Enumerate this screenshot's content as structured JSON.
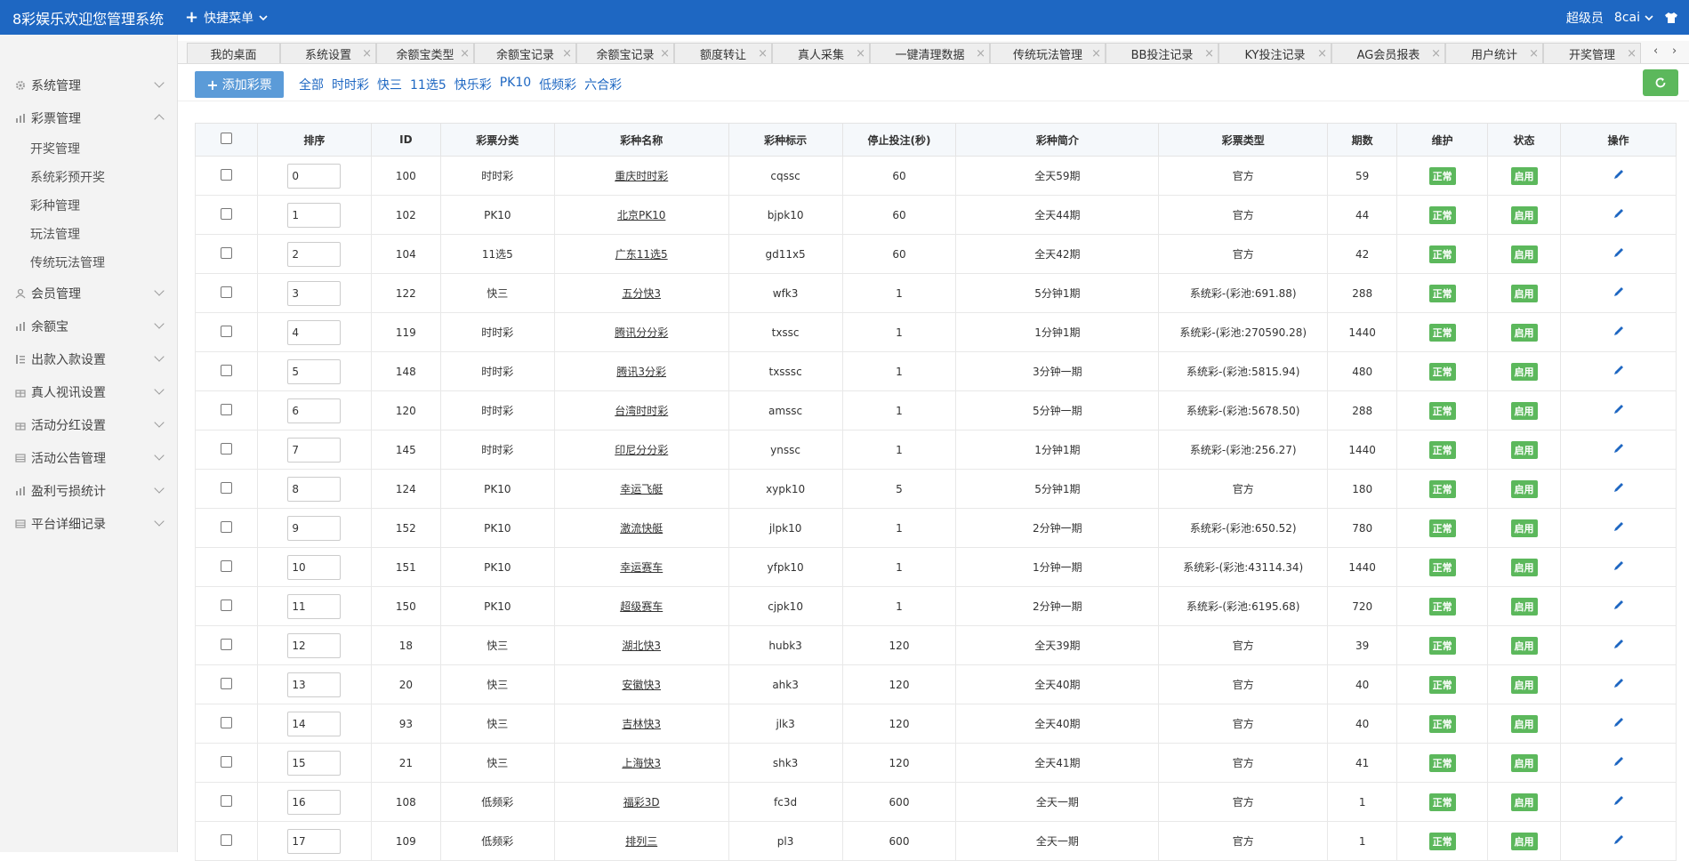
{
  "topbar": {
    "brand": "8彩娱乐欢迎您管理系统",
    "quick_menu": "快捷菜单",
    "role": "超级员",
    "user": "8cai"
  },
  "sidebar": {
    "items": [
      {
        "label": "系统管理"
      },
      {
        "label": "彩票管理"
      },
      {
        "label": "会员管理"
      },
      {
        "label": "余额宝"
      },
      {
        "label": "出款入款设置"
      },
      {
        "label": "真人视讯设置"
      },
      {
        "label": "活动分红设置"
      },
      {
        "label": "活动公告管理"
      },
      {
        "label": "盈利亏损统计"
      },
      {
        "label": "平台详细记录"
      }
    ],
    "subitems": [
      "开奖管理",
      "系统彩预开奖",
      "彩种管理",
      "玩法管理",
      "传统玩法管理"
    ]
  },
  "tabs": [
    "我的桌面",
    "系统设置",
    "余额宝类型",
    "余额宝记录",
    "余额宝记录",
    "额度转让",
    "真人采集",
    "一键清理数据",
    "传统玩法管理",
    "BB投注记录",
    "KY投注记录",
    "AG会员报表",
    "用户统计",
    "开奖管理"
  ],
  "toolbar": {
    "add_label": "添加彩票",
    "filters": [
      "全部",
      "时时彩",
      "快三",
      "11选5",
      "快乐彩",
      "PK10",
      "低频彩",
      "六合彩"
    ]
  },
  "table": {
    "headers": [
      "排序",
      "ID",
      "彩票分类",
      "彩种名称",
      "彩种标示",
      "停止投注(秒)",
      "彩种简介",
      "彩票类型",
      "期数",
      "维护",
      "状态",
      "操作"
    ],
    "maint_label": "正常",
    "status_label": "启用",
    "rows": [
      [
        "0",
        "100",
        "时时彩",
        "重庆时时彩",
        "cqssc",
        "60",
        "全天59期",
        "官方",
        "59"
      ],
      [
        "1",
        "102",
        "PK10",
        "北京PK10",
        "bjpk10",
        "60",
        "全天44期",
        "官方",
        "44"
      ],
      [
        "2",
        "104",
        "11选5",
        "广东11选5",
        "gd11x5",
        "60",
        "全天42期",
        "官方",
        "42"
      ],
      [
        "3",
        "122",
        "快三",
        "五分快3",
        "wfk3",
        "1",
        "5分钟1期",
        "系统彩-(彩池:691.88)",
        "288"
      ],
      [
        "4",
        "119",
        "时时彩",
        "腾讯分分彩",
        "txssc",
        "1",
        "1分钟1期",
        "系统彩-(彩池:270590.28)",
        "1440"
      ],
      [
        "5",
        "148",
        "时时彩",
        "腾讯3分彩",
        "txsssc",
        "1",
        "3分钟一期",
        "系统彩-(彩池:5815.94)",
        "480"
      ],
      [
        "6",
        "120",
        "时时彩",
        "台湾时时彩",
        "amssc",
        "1",
        "5分钟一期",
        "系统彩-(彩池:5678.50)",
        "288"
      ],
      [
        "7",
        "145",
        "时时彩",
        "印尼分分彩",
        "ynssc",
        "1",
        "1分钟1期",
        "系统彩-(彩池:256.27)",
        "1440"
      ],
      [
        "8",
        "124",
        "PK10",
        "幸运飞艇",
        "xypk10",
        "5",
        "5分钟1期",
        "官方",
        "180"
      ],
      [
        "9",
        "152",
        "PK10",
        "激流快艇",
        "jlpk10",
        "1",
        "2分钟一期",
        "系统彩-(彩池:650.52)",
        "780"
      ],
      [
        "10",
        "151",
        "PK10",
        "幸运赛车",
        "yfpk10",
        "1",
        "1分钟一期",
        "系统彩-(彩池:43114.34)",
        "1440"
      ],
      [
        "11",
        "150",
        "PK10",
        "超级赛车",
        "cjpk10",
        "1",
        "2分钟一期",
        "系统彩-(彩池:6195.68)",
        "720"
      ],
      [
        "12",
        "18",
        "快三",
        "湖北快3",
        "hubk3",
        "120",
        "全天39期",
        "官方",
        "39"
      ],
      [
        "13",
        "20",
        "快三",
        "安徽快3",
        "ahk3",
        "120",
        "全天40期",
        "官方",
        "40"
      ],
      [
        "14",
        "93",
        "快三",
        "吉林快3",
        "jlk3",
        "120",
        "全天40期",
        "官方",
        "40"
      ],
      [
        "15",
        "21",
        "快三",
        "上海快3",
        "shk3",
        "120",
        "全天41期",
        "官方",
        "41"
      ],
      [
        "16",
        "108",
        "低频彩",
        "福彩3D",
        "fc3d",
        "600",
        "全天一期",
        "官方",
        "1"
      ],
      [
        "17",
        "109",
        "低频彩",
        "排列三",
        "pl3",
        "600",
        "全天一期",
        "官方",
        "1"
      ]
    ]
  }
}
